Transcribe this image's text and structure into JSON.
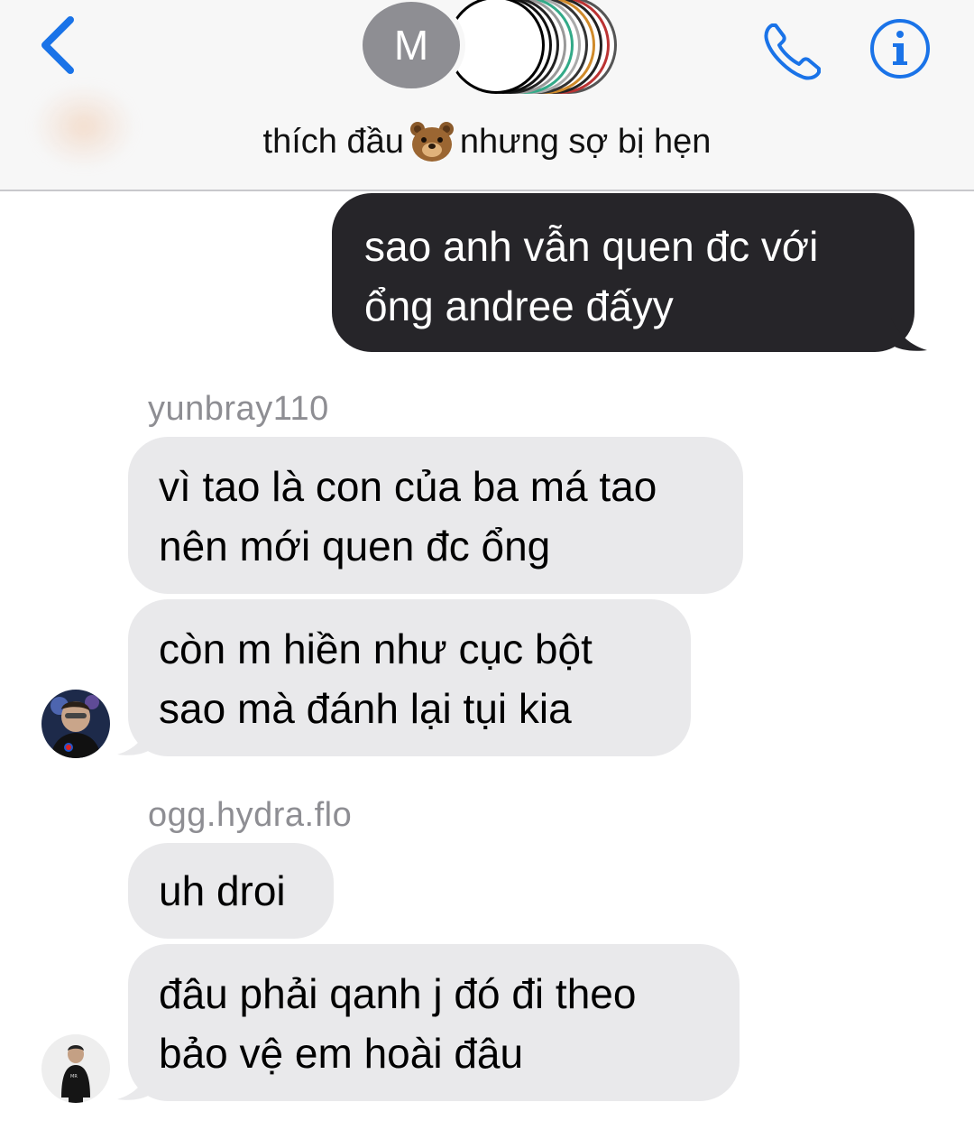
{
  "header": {
    "back_icon": "chevron-left-icon",
    "group_avatar_initial": "M",
    "group_name_part1": "thích đầu",
    "group_name_emoji": "bear-face",
    "group_name_part2": "nhưng sợ bị hẹn",
    "phone_icon": "phone-icon",
    "info_icon": "info-icon",
    "accent_color": "#1a73e8"
  },
  "messages": [
    {
      "direction": "outgoing",
      "text": "sao anh vẫn quen đc với\nổng andree đấyy"
    },
    {
      "direction": "incoming",
      "sender": "yunbray110",
      "text": "vì tao là con của ba má tao\nnên mới quen đc ổng"
    },
    {
      "direction": "incoming",
      "sender": "yunbray110",
      "text": "còn m hiền như cục bột\nsao mà đánh lại tụi kia"
    },
    {
      "direction": "incoming",
      "sender": "ogg.hydra.flo",
      "text": "uh droi"
    },
    {
      "direction": "incoming",
      "sender": "ogg.hydra.flo",
      "text": "đâu phải qanh j đó đi theo\nbảo vệ em hoài đâu"
    }
  ],
  "colors": {
    "outgoing_bubble": "#262529",
    "incoming_bubble": "#e9e9eb",
    "sender_label": "#8e8e93",
    "header_bg": "#f7f7f7"
  }
}
